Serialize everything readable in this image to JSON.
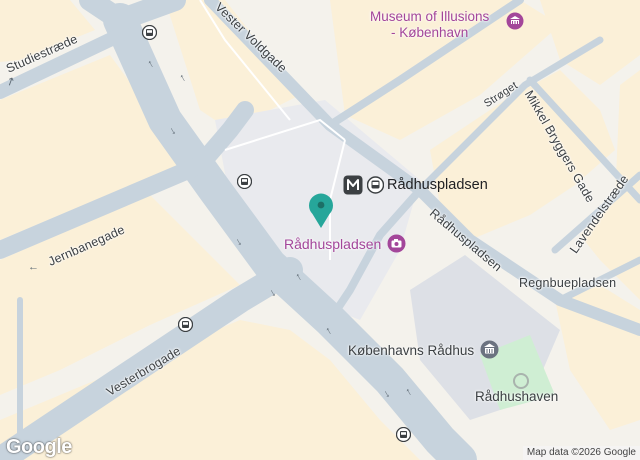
{
  "map": {
    "colors": {
      "background": "#f4f2ec",
      "block": "#fbf0d8",
      "road": "#c7d3dd",
      "road_edge": "#b4c2cd",
      "plaza": "#e9eaee",
      "park": "#cfeed3",
      "building": "#dde0e6",
      "pin": "#26a69a",
      "poi_pink": "#a3469a"
    },
    "roads": {
      "studiestraede": "Studiestræde",
      "vester_voldgade": "Vester Voldgade",
      "jernbanegade": "Jernbanegade",
      "vesterbrogade": "Vesterbrogade",
      "stroget": "Strøget",
      "mikkel_bryggers_gade": "Mikkel Bryggers Gade",
      "lavendelstraede": "Lavendelstræde",
      "radhuspladsen_street": "Rådhuspladsen",
      "regnbuepladsen": "Regnbuepladsen"
    },
    "pois": {
      "museum_line1": "Museum of Illusions",
      "museum_line2": "- København",
      "metro_station": "Rådhuspladsen",
      "square": "Rådhuspladsen",
      "city_hall": "Københavns Rådhus",
      "park": "Rådhushaven"
    },
    "icons": {
      "metro": "metro-icon",
      "bus": "bus-stop-icon",
      "pin": "location-pin-icon",
      "camera": "camera-icon",
      "museum": "museum-icon"
    },
    "footer": {
      "logo": "Google",
      "attribution": "Map data ©2026 Google"
    }
  }
}
